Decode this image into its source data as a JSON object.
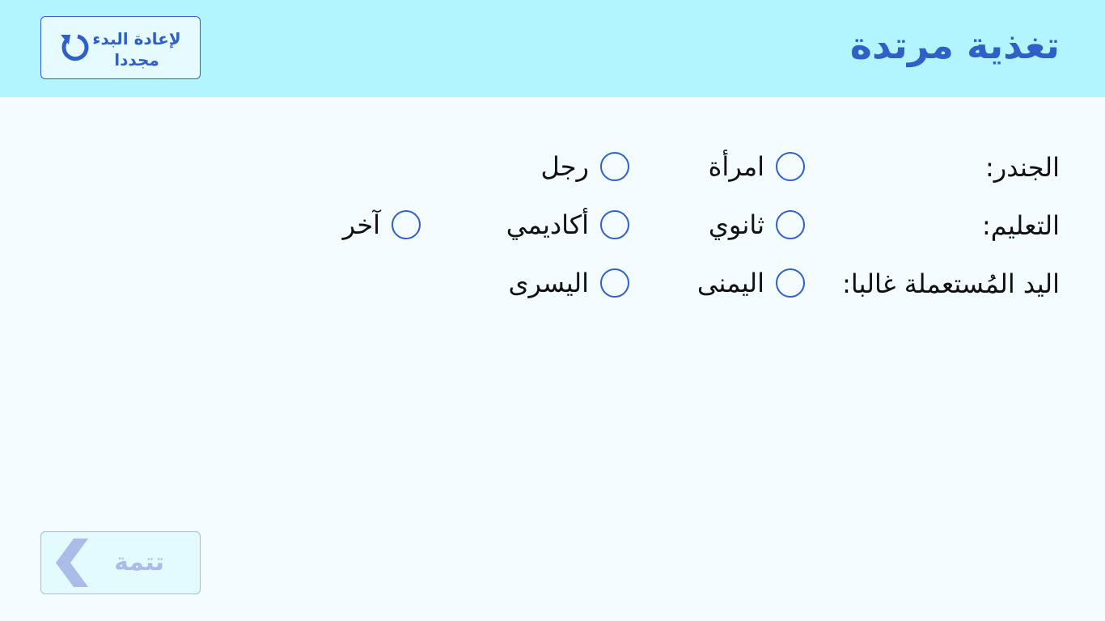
{
  "header": {
    "title": "تغذية مرتدة",
    "restart_label": "لإعادة البدء مجددا",
    "restart_icon": "restart-icon"
  },
  "form": {
    "gender": {
      "label": "الجندر:",
      "options": [
        "امرأة",
        "رجل"
      ]
    },
    "education": {
      "label": "التعليم:",
      "options": [
        "ثانوي",
        "أكاديمي",
        "آخر"
      ]
    },
    "handedness": {
      "label": "اليد المُستعملة غالبا:",
      "options": [
        "اليمنى",
        "اليسرى"
      ]
    }
  },
  "footer": {
    "next_label": "تتمة",
    "next_icon": "chevron-left-icon"
  },
  "colors": {
    "header_bg": "#b2f5ff",
    "page_bg": "#f3fcff",
    "accent": "#2f5fc7",
    "disabled": "#aabde8"
  }
}
